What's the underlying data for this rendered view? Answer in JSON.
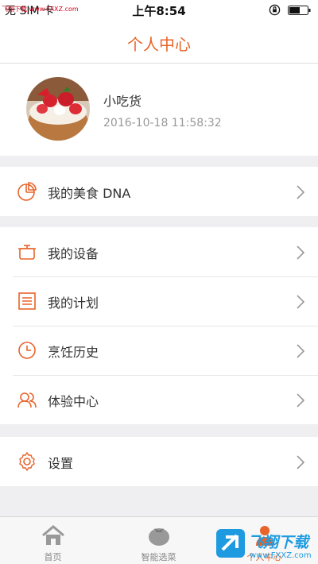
{
  "status_bar": {
    "carrier": "无 SIM 卡",
    "watermark": "飞翔下载 www.FXXZ.com",
    "time": "上午8:54"
  },
  "header": {
    "title": "个人中心"
  },
  "profile": {
    "username": "小吃货",
    "timestamp": "2016-10-18 11:58:32"
  },
  "menu": {
    "dna": {
      "label": "我的美食 DNA",
      "icon": "pie-chart-icon"
    },
    "devices": {
      "label": "我的设备",
      "icon": "pot-icon"
    },
    "plans": {
      "label": "我的计划",
      "icon": "notebook-icon"
    },
    "history": {
      "label": "烹饪历史",
      "icon": "clock-icon"
    },
    "experience": {
      "label": "体验中心",
      "icon": "people-icon"
    },
    "settings": {
      "label": "设置",
      "icon": "gear-icon"
    }
  },
  "tabs": [
    {
      "label": "首页",
      "icon": "home-icon"
    },
    {
      "label": "智能选菜",
      "icon": "tomato-icon"
    },
    {
      "label": "个人中心",
      "icon": "person-icon",
      "active": true
    }
  ],
  "watermark_stamp": {
    "title": "飞翔下载",
    "url": "www.FXXZ.com"
  },
  "colors": {
    "accent": "#e8642a",
    "background": "#efeff2"
  }
}
